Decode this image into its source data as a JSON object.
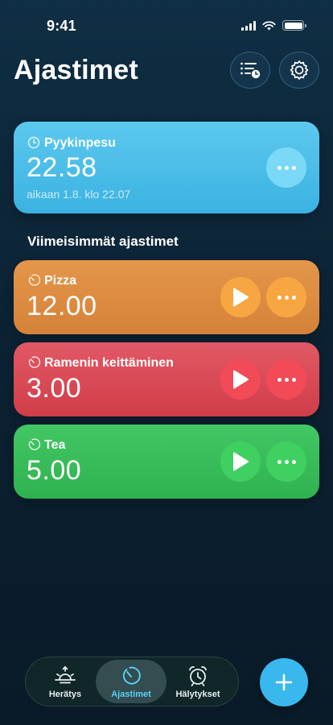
{
  "status_bar": {
    "time": "9:41"
  },
  "header": {
    "title": "Ajastimet",
    "list_icon": "timer-list-icon",
    "settings_icon": "settings-icon"
  },
  "active_timer": {
    "name": "Pyykinpesu",
    "time": "22.58",
    "subtitle": "aikaan 1.8. klo 22.07",
    "color": "#49bde7"
  },
  "recent": {
    "title": "Viimeisimmät ajastimet",
    "items": [
      {
        "name": "Pizza",
        "time": "12.00",
        "color": "#dc8b41"
      },
      {
        "name": "Ramenin keittäminen",
        "time": "3.00",
        "color": "#d84a55"
      },
      {
        "name": "Tea",
        "time": "5.00",
        "color": "#38bc59"
      }
    ]
  },
  "tab_bar": {
    "tabs": [
      {
        "label": "Herätys",
        "icon": "sunrise-icon",
        "active": false
      },
      {
        "label": "Ajastimet",
        "icon": "timer-icon",
        "active": true
      },
      {
        "label": "Hälytykset",
        "icon": "alarm-clock-icon",
        "active": false
      }
    ]
  },
  "fab": {
    "icon": "plus-icon",
    "color": "#38b8ec"
  },
  "colors": {
    "accent": "#5ad0f5",
    "background": "#0c2234"
  }
}
